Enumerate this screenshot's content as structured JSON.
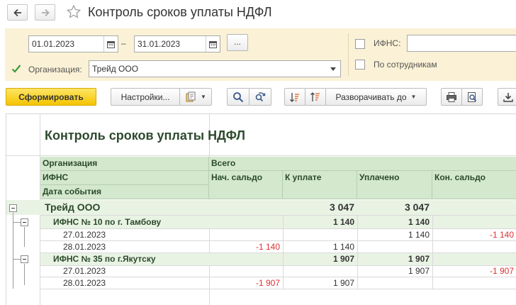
{
  "window": {
    "title": "Контроль сроков уплаты НДФЛ"
  },
  "filters": {
    "date_from": "01.01.2023",
    "date_separator": "–",
    "date_to": "31.01.2023",
    "more_button": "...",
    "org_label": "Организация:",
    "org_value": "Трейд ООО",
    "org_checked": true,
    "ifns_label": "ИФНС:",
    "ifns_value": "",
    "by_employees_label": "По сотрудникам"
  },
  "toolbar": {
    "generate": "Сформировать",
    "settings": "Настройки...",
    "expand_to": "Разворачивать до"
  },
  "report": {
    "title": "Контроль сроков уплаты НДФЛ",
    "headers": {
      "org": "Организация",
      "ifns": "ИФНС",
      "event_date": "Дата события",
      "total": "Всего",
      "start_balance": "Нач. сальдо",
      "to_pay": "К уплате",
      "paid": "Уплачено",
      "end_balance": "Кон. сальдо"
    },
    "rows": [
      {
        "label": "Трейд ООО",
        "start": "",
        "to_pay": "3 047",
        "paid": "3 047",
        "end": ""
      },
      {
        "label": "ИФНС № 10 по г. Тамбову",
        "start": "",
        "to_pay": "1 140",
        "paid": "1 140",
        "end": ""
      },
      {
        "label": "27.01.2023",
        "start": "",
        "to_pay": "",
        "paid": "1 140",
        "end": "-1 140"
      },
      {
        "label": "28.01.2023",
        "start": "-1 140",
        "to_pay": "1 140",
        "paid": "",
        "end": ""
      },
      {
        "label": "ИФНС № 35 по г.Якутску",
        "start": "",
        "to_pay": "1 907",
        "paid": "1 907",
        "end": ""
      },
      {
        "label": "27.01.2023",
        "start": "",
        "to_pay": "",
        "paid": "1 907",
        "end": "-1 907"
      },
      {
        "label": "28.01.2023",
        "start": "-1 907",
        "to_pay": "1 907",
        "paid": "",
        "end": ""
      }
    ]
  },
  "colors": {
    "filter_bg": "#fbf1d6",
    "header_bg": "#d3e8cd",
    "group_bg": "#e9f3e4",
    "negative": "#e03030",
    "primary_btn": "#f4c400"
  }
}
